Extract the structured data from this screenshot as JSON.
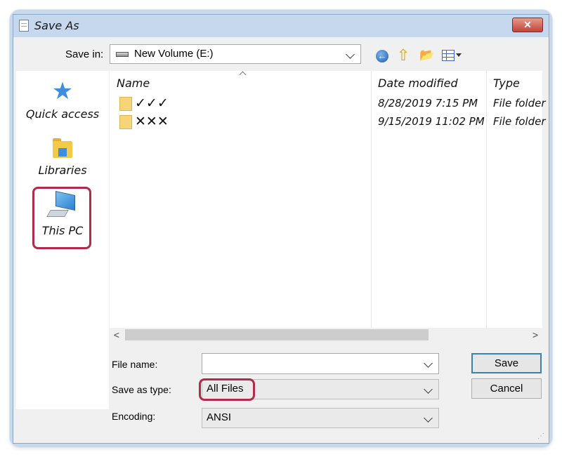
{
  "window": {
    "title": "Save As",
    "close_glyph": "✕"
  },
  "toolbar": {
    "save_in_label": "Save in:",
    "save_in_value": "New Volume (E:)",
    "icons": [
      "back-icon",
      "up-folder-icon",
      "new-folder-icon",
      "view-menu-icon"
    ]
  },
  "places": [
    {
      "label": "Quick access",
      "icon": "star-icon"
    },
    {
      "label": "Libraries",
      "icon": "libraries-icon"
    },
    {
      "label": "This PC",
      "icon": "computer-icon"
    }
  ],
  "list": {
    "columns": [
      "Name",
      "Date modified",
      "Type"
    ],
    "rows": [
      {
        "name": "✓✓✓",
        "date": "8/28/2019 7:15 PM",
        "type": "File folder"
      },
      {
        "name": "✕✕✕",
        "date": "9/15/2019 11:02 PM",
        "type": "File folder"
      }
    ]
  },
  "scroll": {
    "left": "<",
    "right": ">"
  },
  "form": {
    "file_name_label": "File name:",
    "file_name_value": "",
    "save_as_type_label": "Save as type:",
    "save_as_type_value": "All Files",
    "encoding_label": "Encoding:",
    "encoding_value": "ANSI"
  },
  "buttons": {
    "save": "Save",
    "cancel": "Cancel"
  },
  "colors": {
    "highlight": "#b12b4a",
    "titlebar": "#c6d8ee",
    "accent": "#3c7fb1"
  }
}
